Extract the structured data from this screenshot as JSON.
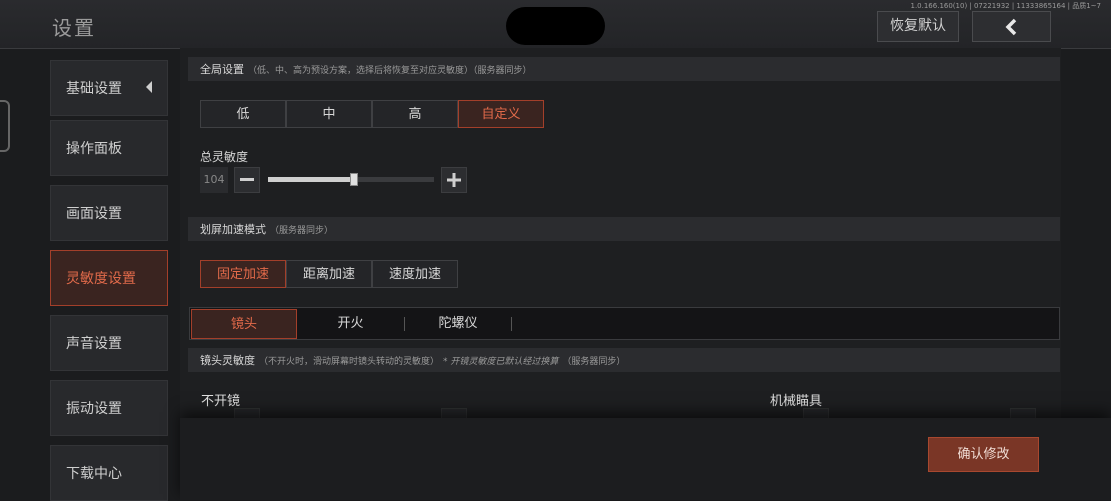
{
  "header": {
    "title": "设置",
    "version": "1.0.166.160(10) | 07221932 | 11333865164 | 品质1~7",
    "reset_label": "恢复默认"
  },
  "sidebar": {
    "items": [
      {
        "label": "基础设置"
      },
      {
        "label": "操作面板"
      },
      {
        "label": "画面设置"
      },
      {
        "label": "灵敏度设置"
      },
      {
        "label": "声音设置"
      },
      {
        "label": "振动设置"
      },
      {
        "label": "下载中心"
      }
    ]
  },
  "global": {
    "title": "全局设置",
    "note": "（低、中、高为预设方案，选择后将恢复至对应灵敏度）（服务器同步）",
    "options": [
      "低",
      "中",
      "高",
      "自定义"
    ],
    "selected": "自定义"
  },
  "total": {
    "label": "总灵敏度",
    "value": "104",
    "slider_fraction": 0.52
  },
  "swipe": {
    "title": "划屏加速模式",
    "note": "（服务器同步）",
    "options": [
      "固定加速",
      "距离加速",
      "速度加速"
    ],
    "selected": "固定加速"
  },
  "tabs": {
    "items": [
      "镜头",
      "开火",
      "陀螺仪"
    ],
    "selected": "镜头"
  },
  "lens": {
    "title": "镜头灵敏度",
    "note": "（不开火时，滑动屏幕时镜头转动的灵敏度）",
    "note_italic": "* 开镜灵敏度已默认经过换算",
    "note_tail": "（服务器同步）",
    "left_label": "不开镜",
    "right_label": "机械瞄具"
  },
  "footer": {
    "confirm_label": "确认修改"
  },
  "colors": {
    "accent": "#e26a4a",
    "accent_border": "#a33f2a"
  }
}
